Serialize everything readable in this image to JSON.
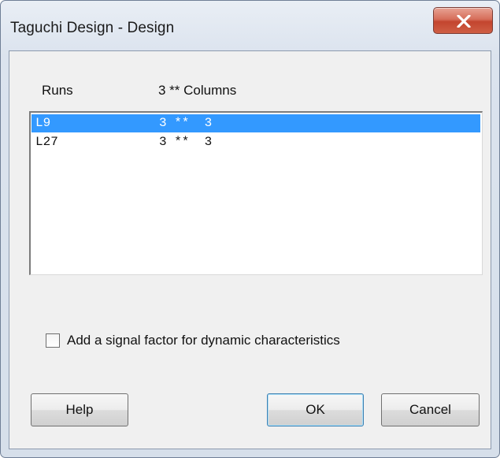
{
  "window": {
    "title": "Taguchi Design - Design",
    "close_icon": "close-x-icon",
    "accent_close": "#c3452e"
  },
  "columns": {
    "runs": "Runs",
    "columns": "3 ** Columns"
  },
  "list": {
    "rows": [
      {
        "run": "L9",
        "cols": "3 **  3",
        "selected": true
      },
      {
        "run": "L27",
        "cols": "3 **  3",
        "selected": false
      }
    ],
    "selection_color": "#3399ff"
  },
  "options": {
    "signal_factor_label": "Add a signal factor for dynamic characteristics",
    "signal_factor_checked": false
  },
  "buttons": {
    "help": "Help",
    "ok": "OK",
    "cancel": "Cancel"
  }
}
